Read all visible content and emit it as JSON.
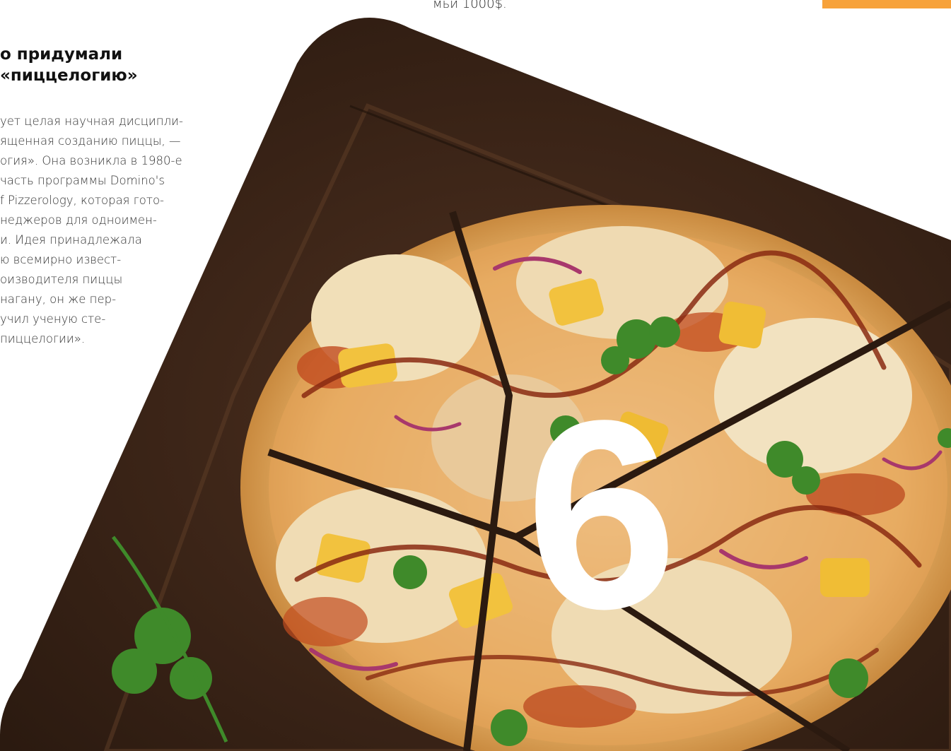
{
  "top_text": "мьи 1000$.",
  "heading": "о придумали\n«пиццелогию»",
  "body_lines": [
    "ует целая научная дисципли-",
    "ященная созданию пиццы, —",
    "огия». Она возникла в 1980-е",
    "часть программы Domino's",
    "f Pizzerology, которая гото-",
    "неджеров для одноимен-",
    "и. Идея принадлежала",
    "ю всемирно извест-",
    "оизводителя пиццы",
    "нагану, он же пер-",
    "учил ученую сте-",
    "пиццелогии»."
  ],
  "big_number": "6",
  "colors": {
    "accent": "#f7a23a",
    "board": "#3a2416",
    "board_light": "#4a2e1c",
    "crust": "#e9b46a",
    "sauce": "#c24b1f",
    "cheese": "#f3e6c8",
    "pineapple": "#f2c23e",
    "onion": "#a8386c",
    "cilantro": "#3f8a2a",
    "number": "#ffffff"
  }
}
